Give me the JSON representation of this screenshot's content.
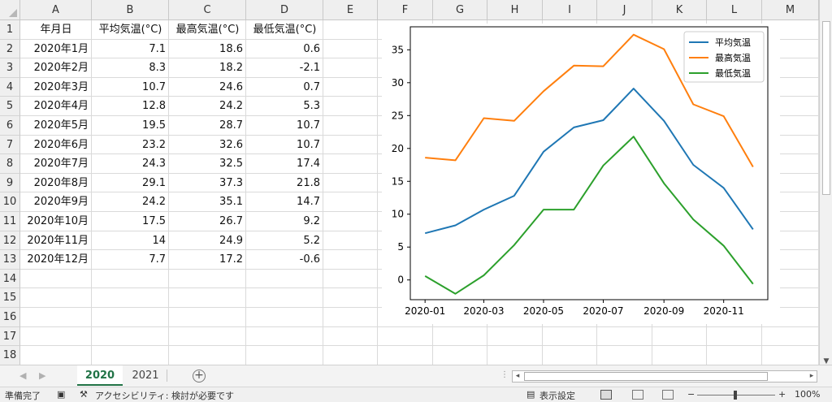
{
  "sheet": {
    "columns": [
      "A",
      "B",
      "C",
      "D",
      "E",
      "F",
      "G",
      "H",
      "I",
      "J",
      "K",
      "L",
      "M"
    ],
    "rows": [
      "1",
      "2",
      "3",
      "4",
      "5",
      "6",
      "7",
      "8",
      "9",
      "10",
      "11",
      "12",
      "13",
      "14",
      "15",
      "16",
      "17",
      "18"
    ],
    "header_row": [
      "年月日",
      "平均気温(°C)",
      "最高気温(°C)",
      "最低気温(°C)"
    ],
    "data": [
      [
        "2020年1月",
        "7.1",
        "18.6",
        "0.6"
      ],
      [
        "2020年2月",
        "8.3",
        "18.2",
        "-2.1"
      ],
      [
        "2020年3月",
        "10.7",
        "24.6",
        "0.7"
      ],
      [
        "2020年4月",
        "12.8",
        "24.2",
        "5.3"
      ],
      [
        "2020年5月",
        "19.5",
        "28.7",
        "10.7"
      ],
      [
        "2020年6月",
        "23.2",
        "32.6",
        "10.7"
      ],
      [
        "2020年7月",
        "24.3",
        "32.5",
        "17.4"
      ],
      [
        "2020年8月",
        "29.1",
        "37.3",
        "21.8"
      ],
      [
        "2020年9月",
        "24.2",
        "35.1",
        "14.7"
      ],
      [
        "2020年10月",
        "17.5",
        "26.7",
        "9.2"
      ],
      [
        "2020年11月",
        "14",
        "24.9",
        "5.2"
      ],
      [
        "2020年12月",
        "7.7",
        "17.2",
        "-0.6"
      ]
    ]
  },
  "chart_data": {
    "type": "line",
    "x": [
      "2020-01-01",
      "2020-02-01",
      "2020-03-01",
      "2020-04-01",
      "2020-05-01",
      "2020-06-01",
      "2020-07-01",
      "2020-08-01",
      "2020-09-01",
      "2020-10-01",
      "2020-11-01",
      "2020-12-01"
    ],
    "x_tick_labels": [
      "2020-01",
      "2020-03",
      "2020-05",
      "2020-07",
      "2020-09",
      "2020-11"
    ],
    "y_ticks": [
      0,
      5,
      10,
      15,
      20,
      25,
      30,
      35
    ],
    "ylim": [
      -3,
      38.5
    ],
    "grid": false,
    "legend_position": "top-right",
    "series": [
      {
        "name": "平均気温",
        "color": "#1f77b4",
        "values": [
          7.1,
          8.3,
          10.7,
          12.8,
          19.5,
          23.2,
          24.3,
          29.1,
          24.2,
          17.5,
          14,
          7.7
        ]
      },
      {
        "name": "最高気温",
        "color": "#ff7f0e",
        "values": [
          18.6,
          18.2,
          24.6,
          24.2,
          28.7,
          32.6,
          32.5,
          37.3,
          35.1,
          26.7,
          24.9,
          17.2
        ]
      },
      {
        "name": "最低気温",
        "color": "#2ca02c",
        "values": [
          0.6,
          -2.1,
          0.7,
          5.3,
          10.7,
          10.7,
          17.4,
          21.8,
          14.7,
          9.2,
          5.2,
          -0.6
        ]
      }
    ]
  },
  "tabs": [
    {
      "label": "2020",
      "active": true
    },
    {
      "label": "2021",
      "active": false
    }
  ],
  "status": {
    "ready": "準備完了",
    "accessibility": "アクセシビリティ: 検討が必要です",
    "display_settings": "表示設定",
    "zoom": "100%",
    "zoom_minus": "−",
    "zoom_plus": "+"
  },
  "colors": {
    "accent": "#217346",
    "grid": "#dadada",
    "header_bg": "#efefef"
  }
}
